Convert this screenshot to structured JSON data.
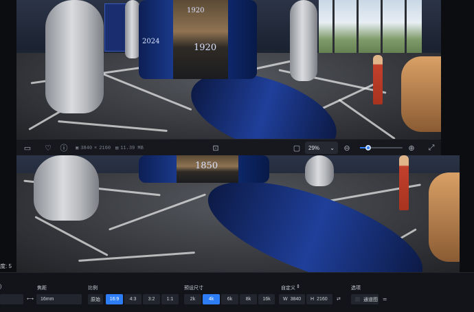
{
  "scene": {
    "top_years": [
      "1920",
      "2024",
      "1920"
    ],
    "bottom_years": [
      "1850"
    ]
  },
  "viewer_bar": {
    "icons": {
      "layout": "frame-icon",
      "like": "heart-icon",
      "info": "info-icon",
      "image": "image-icon",
      "save": "save-icon",
      "focus": "focus-icon",
      "screen": "screen-icon",
      "zoom_out": "zoom-out-icon",
      "zoom_in": "zoom-in-icon",
      "fullscreen": "fullscreen-icon"
    },
    "width": "3840",
    "times": "×",
    "height": "2160",
    "file_size": "11.39 MB",
    "zoom": "29%",
    "zoom_level": 0.2
  },
  "side": {
    "label": "度: 5"
  },
  "panel": {
    "col0_label": ")",
    "focal_label": "焦距",
    "focal_value": "16mm",
    "ratio_label": "比例",
    "ratios": [
      "原始",
      "16:9",
      "4:3",
      "3:2",
      "1:1"
    ],
    "ratio_selected": "16:9",
    "preset_label": "预设尺寸",
    "presets": [
      "2k",
      "4k",
      "6k",
      "8k",
      "16k"
    ],
    "preset_selected": "4k",
    "custom_label": "自定义",
    "custom_w_prefix": "W",
    "custom_w": "3840",
    "custom_h_prefix": "H",
    "custom_h": "2160",
    "options_label": "选项",
    "channel_label": "通道图"
  },
  "colors": {
    "accent": "#2d7df6",
    "background": "#121419"
  }
}
